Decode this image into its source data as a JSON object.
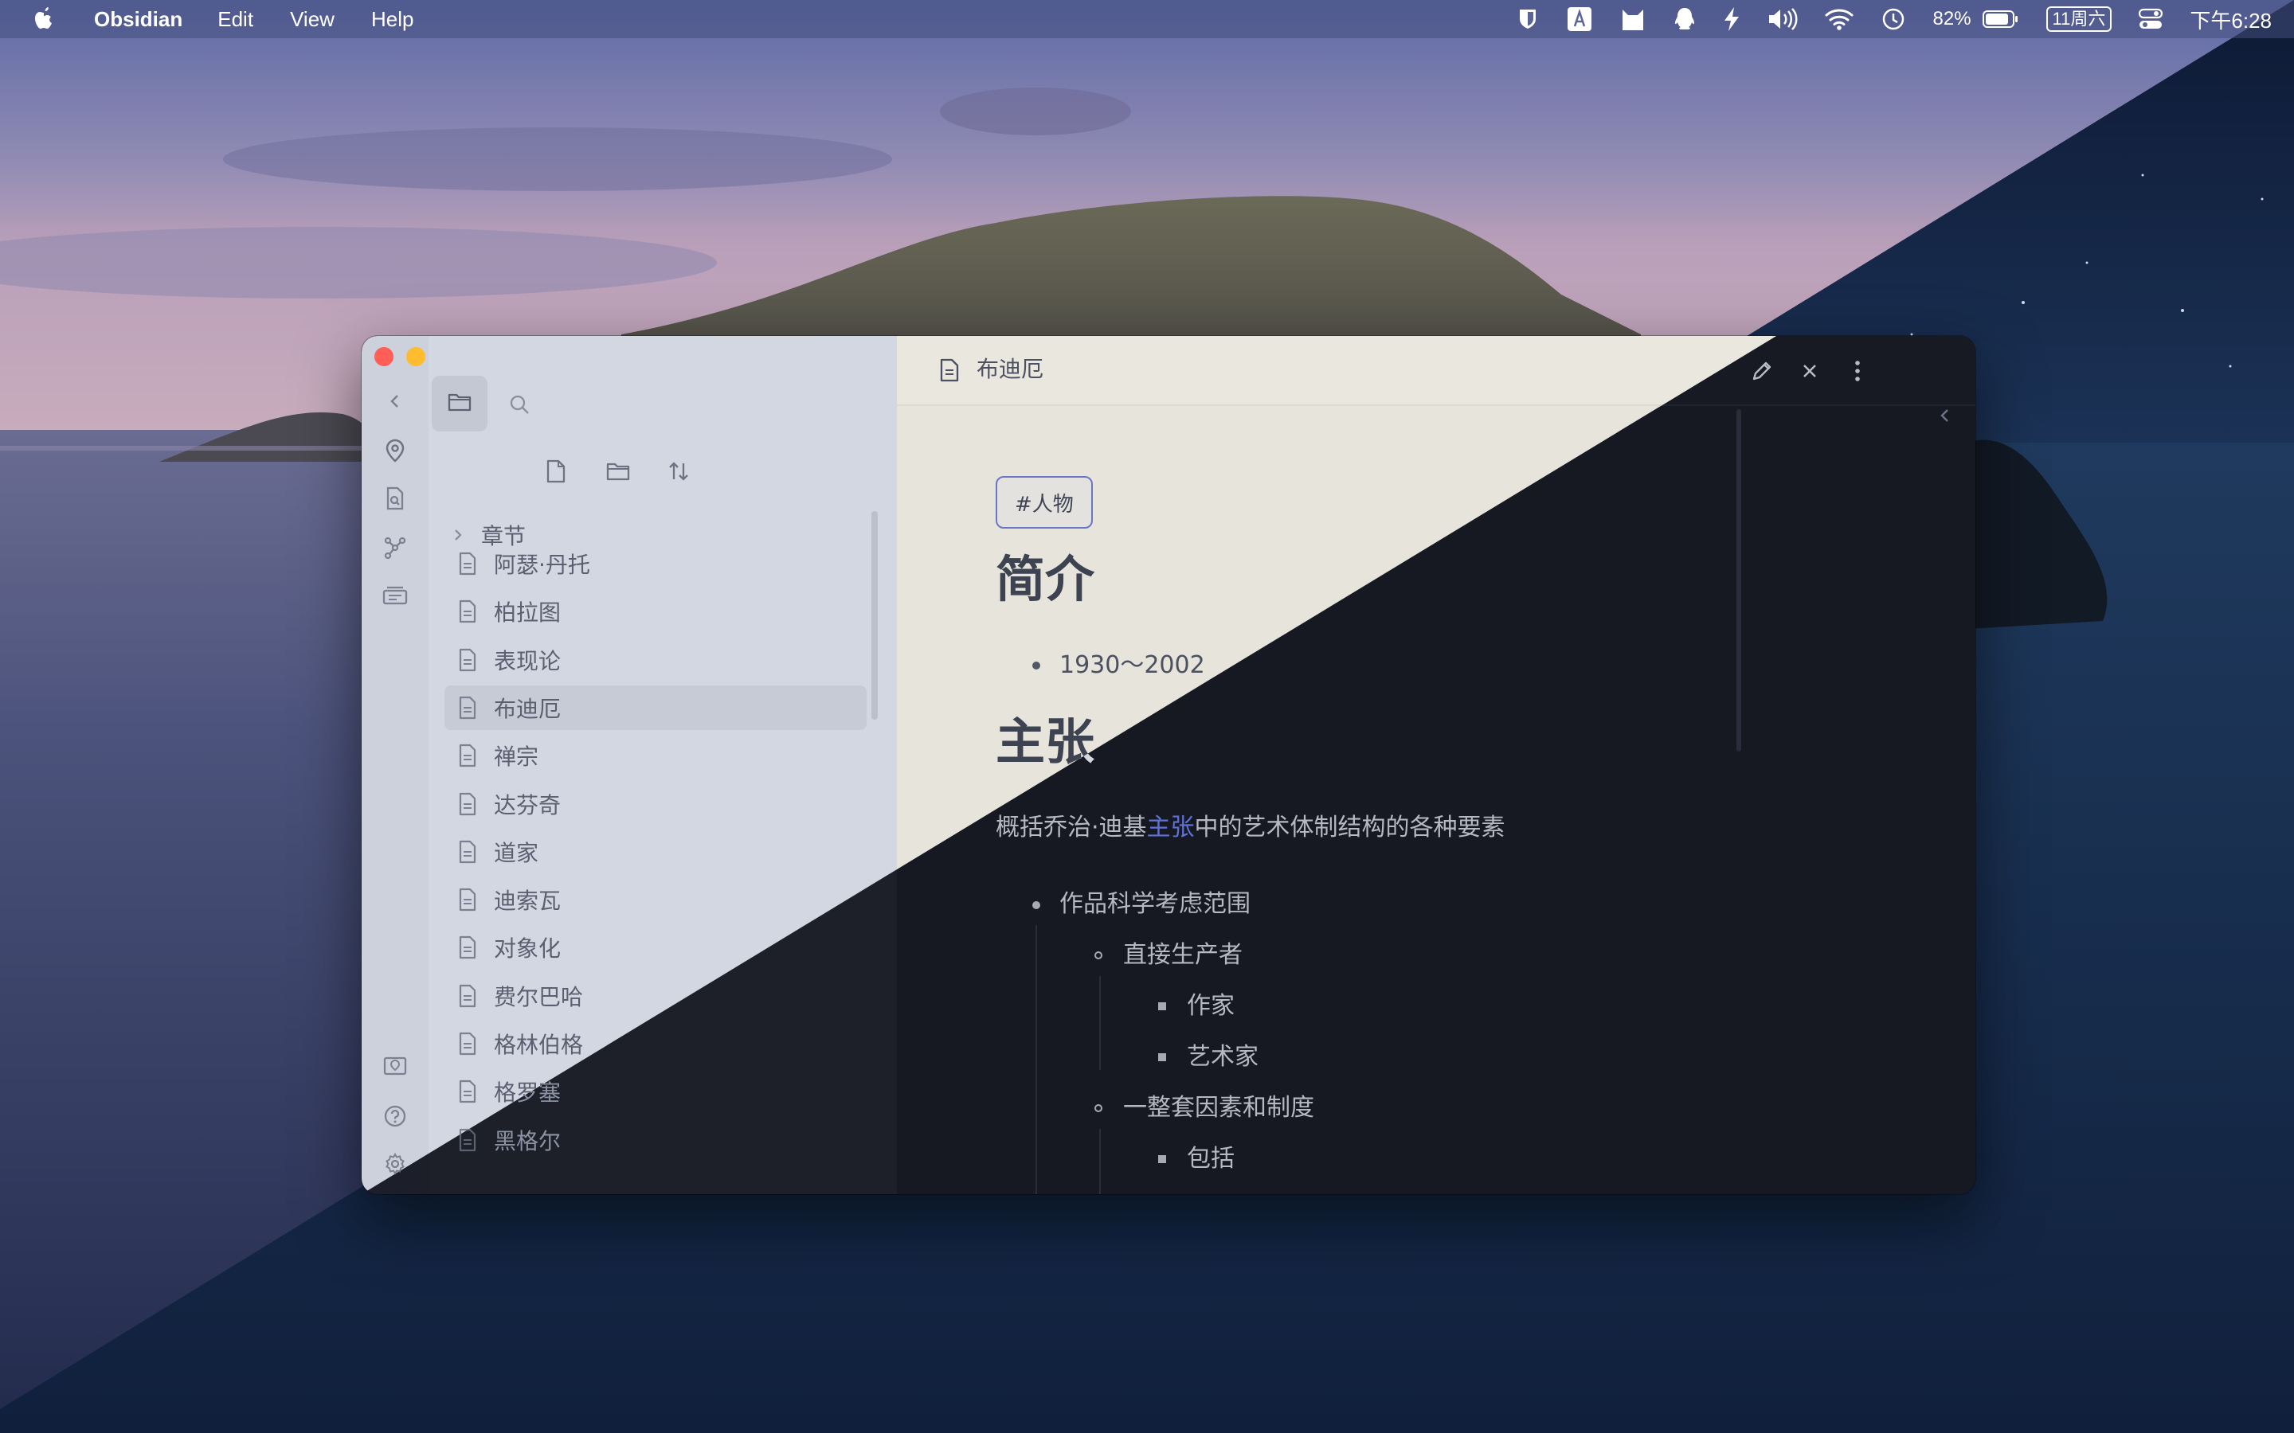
{
  "menubar": {
    "app_name": "Obsidian",
    "menus": [
      "Edit",
      "View",
      "Help"
    ],
    "battery": "82%",
    "date": "11周六",
    "time": "下午6:28",
    "tray_icons": [
      "bitwarden-icon",
      "input-method-icon",
      "cat-icon",
      "qq-icon",
      "bolt-icon",
      "volume-icon",
      "wifi-icon",
      "time-machine-icon",
      "battery-icon",
      "control-center-icon"
    ]
  },
  "ribbon": {
    "icons": [
      "collapse-icon",
      "location-icon",
      "search-file-icon",
      "graph-icon",
      "slides-icon",
      "vault-icon",
      "help-icon",
      "settings-icon"
    ]
  },
  "sidebar": {
    "tabs": [
      "folder-icon",
      "search-icon"
    ],
    "actions": [
      "new-note-icon",
      "new-folder-icon",
      "sort-icon"
    ],
    "folder": "章节",
    "files": [
      "阿瑟·丹托",
      "柏拉图",
      "表现论",
      "布迪厄",
      "禅宗",
      "达芬奇",
      "道家",
      "迪索瓦",
      "对象化",
      "费尔巴哈",
      "格林伯格",
      "格罗塞",
      "黑格尔"
    ],
    "active_file": "布迪厄"
  },
  "editor": {
    "title": "布迪厄",
    "tag": "#人物",
    "h1_intro": "简介",
    "dates": "1930～2002",
    "h1_claim": "主张",
    "para_before": "概括乔治·迪基",
    "para_link": "主张",
    "para_after": "中的艺术体制结构的各种要素",
    "list": {
      "item1": "作品科学考虑范围",
      "item1_1": "直接生产者",
      "item1_1_1": "作家",
      "item1_1_2": "艺术家",
      "item1_2": "一整套因素和制度",
      "item1_2_1": "包括"
    }
  }
}
